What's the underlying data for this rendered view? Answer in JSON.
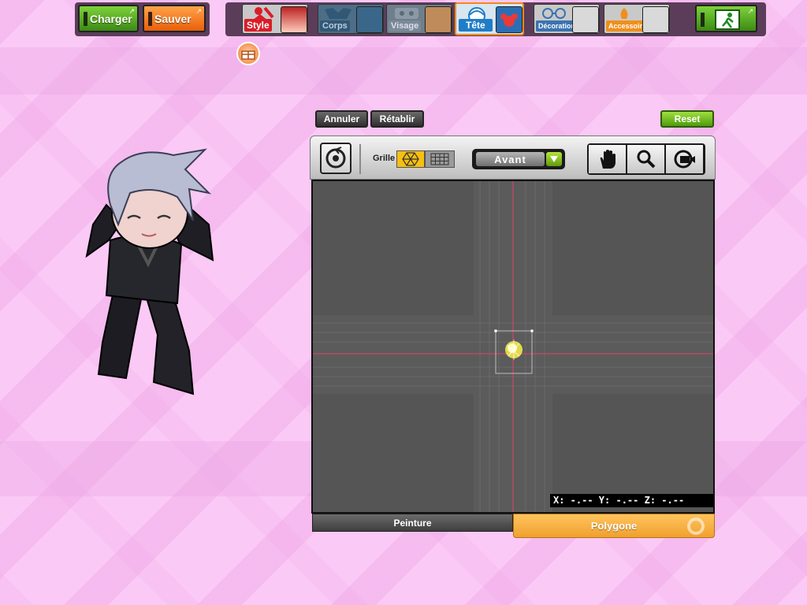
{
  "file": {
    "load_label": "Charger",
    "save_label": "Sauver"
  },
  "categories": [
    {
      "label": "Style"
    },
    {
      "label": "Corps"
    },
    {
      "label": "Visage"
    },
    {
      "label": "Tête"
    },
    {
      "label": "Décoration"
    },
    {
      "label": "Accessoire"
    }
  ],
  "edit": {
    "undo_label": "Annuler",
    "redo_label": "Rétablir",
    "reset_label": "Reset"
  },
  "toolbar": {
    "grid_label": "Grille",
    "view_value": "Avant"
  },
  "canvas": {
    "coords_text": "X: -.-- Y: -.-- Z: -.--"
  },
  "tabs": {
    "paint_label": "Peinture",
    "polygon_label": "Polygone"
  },
  "colors": {
    "accent_orange": "#f08a1c",
    "accent_green": "#5f9a10",
    "background_pink": "#fbc9f5",
    "canvas_gray": "#555555"
  }
}
